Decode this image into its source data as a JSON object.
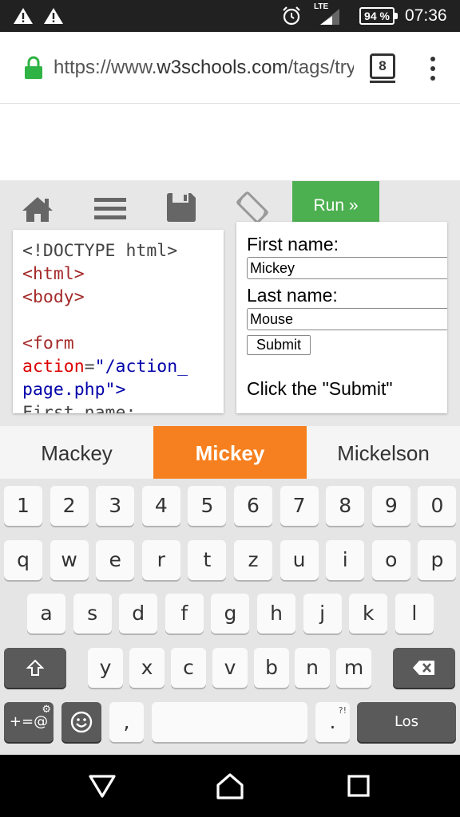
{
  "status_bar": {
    "time": "07:36",
    "battery": "94 %",
    "network": "LTE",
    "icons": [
      "warning-icon",
      "warning-icon",
      "alarm-icon",
      "signal-icon",
      "battery-icon"
    ]
  },
  "browser": {
    "url_prefix": "https://www.",
    "url_host": "w3schools.com",
    "url_rest": "/tags/tryit.asp",
    "tab_count": "8"
  },
  "toolbar": {
    "run_label": "Run »",
    "icons": [
      "home-icon",
      "menu-icon",
      "save-icon",
      "rotate-icon"
    ]
  },
  "code_lines": [
    {
      "parts": [
        {
          "t": "<!DOCTYPE html>",
          "c": "plain"
        }
      ]
    },
    {
      "parts": [
        {
          "t": "<html>",
          "c": "tag"
        }
      ]
    },
    {
      "parts": [
        {
          "t": "<body>",
          "c": "tag"
        }
      ]
    },
    {
      "parts": [
        {
          "t": "",
          "c": "plain"
        }
      ]
    },
    {
      "parts": [
        {
          "t": "<form",
          "c": "tag"
        }
      ]
    },
    {
      "parts": [
        {
          "t": "action",
          "c": "attr"
        },
        {
          "t": "=",
          "c": "plain"
        },
        {
          "t": "\"/action_",
          "c": "val"
        }
      ]
    },
    {
      "parts": [
        {
          "t": "page.php\">",
          "c": "val"
        }
      ]
    },
    {
      "parts": [
        {
          "t": "First name:",
          "c": "plain"
        }
      ]
    }
  ],
  "result": {
    "first_label": "First name:",
    "first_value": "Mickey",
    "last_label": "Last name:",
    "last_value": "Mouse",
    "submit_label": "Submit",
    "note": "Click the \"Submit\""
  },
  "suggestions": {
    "left": "Mackey",
    "center": "Mickey",
    "right": "Mickelson"
  },
  "keyboard": {
    "row_numbers": [
      "1",
      "2",
      "3",
      "4",
      "5",
      "6",
      "7",
      "8",
      "9",
      "0"
    ],
    "row_top": [
      "q",
      "w",
      "e",
      "r",
      "t",
      "z",
      "u",
      "i",
      "o",
      "p"
    ],
    "row_mid": [
      "a",
      "s",
      "d",
      "f",
      "g",
      "h",
      "j",
      "k",
      "l"
    ],
    "row_bottom": [
      "y",
      "x",
      "c",
      "v",
      "b",
      "n",
      "m"
    ],
    "symbols_label": "+=@",
    "comma": ",",
    "period": ".",
    "period_hint": "?!",
    "enter_label": "Los",
    "space_label": ""
  },
  "colors": {
    "run_green": "#4caf50",
    "suggestion_orange": "#f6801f",
    "lock_green": "#2fb344"
  }
}
